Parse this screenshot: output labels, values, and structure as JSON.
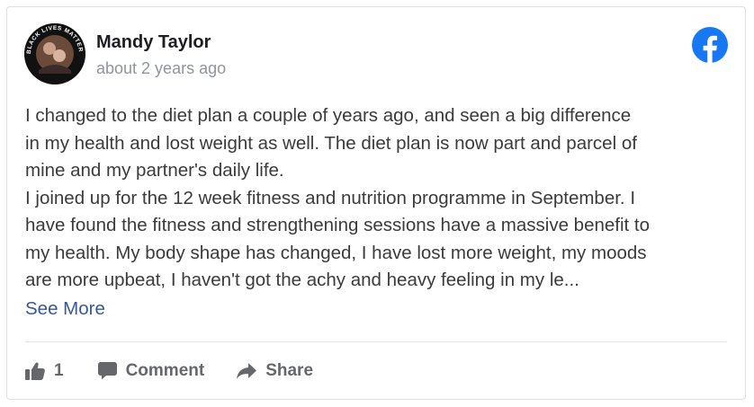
{
  "post": {
    "author": "Mandy Taylor",
    "timestamp": "about 2 years ago",
    "avatar_ring_text": "BLACK LIVES MATTER",
    "body_lines": [
      "I changed to the diet plan a couple of years ago, and seen a big difference",
      "in my health and lost weight as well. The diet plan is now part and parcel of",
      "mine and my partner's daily life.",
      "I joined up for the 12 week fitness and nutrition programme in September. I",
      "have found the fitness and strengthening sessions have a massive benefit to",
      "my health. My body shape has changed, I have lost more weight, my moods",
      "are more upbeat, I haven't got the achy and heavy feeling in my le..."
    ],
    "see_more_label": "See More"
  },
  "actions": {
    "like_count": "1",
    "comment_label": "Comment",
    "share_label": "Share"
  },
  "icons": {
    "brand": "facebook-icon",
    "like": "thumbs-up-icon",
    "comment": "comment-bubble-icon",
    "share": "share-arrow-icon"
  },
  "colors": {
    "facebook_blue": "#1877f2",
    "link": "#385898",
    "muted": "#65676b",
    "timestamp": "#90949c"
  }
}
